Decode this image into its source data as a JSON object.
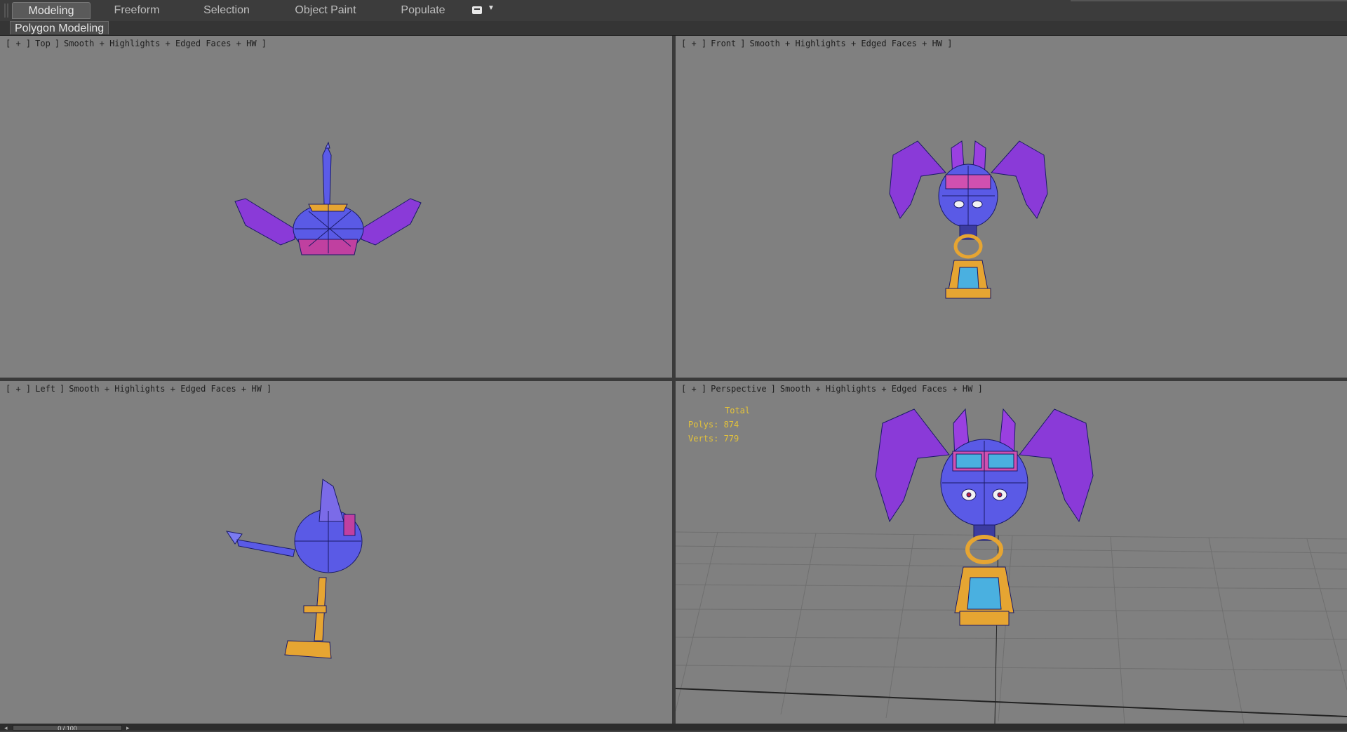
{
  "ribbon": {
    "tabs": [
      {
        "label": "Modeling",
        "active": true
      },
      {
        "label": "Freeform",
        "active": false
      },
      {
        "label": "Selection",
        "active": false
      },
      {
        "label": "Object Paint",
        "active": false
      },
      {
        "label": "Populate",
        "active": false
      }
    ],
    "panel_label": "Polygon Modeling"
  },
  "viewports": {
    "top": {
      "parts": [
        "[ + ]",
        "Top",
        "]",
        "Smooth + Highlights + Edged Faces + HW ]"
      ]
    },
    "front": {
      "parts": [
        "[ + ]",
        "Front",
        "]",
        "Smooth + Highlights + Edged Faces + HW ]"
      ]
    },
    "left": {
      "parts": [
        "[ + ]",
        "Left",
        "]",
        "Smooth + Highlights + Edged Faces + HW ]"
      ]
    },
    "perspective": {
      "parts": [
        "[ + ]",
        "Perspective",
        "]",
        "Smooth + Highlights + Edged Faces + HW ]"
      ],
      "stats": {
        "title": "Total",
        "polys": "Polys: 874",
        "verts": "Verts: 779"
      }
    }
  },
  "timeline": {
    "slider_text": "0 / 100"
  },
  "colors": {
    "viewport_bg": "#808080",
    "stats_text": "#e3c23a",
    "model_body": "#5a5ae6",
    "model_wing": "#8a2be2",
    "model_lantern": "#e6a532"
  }
}
